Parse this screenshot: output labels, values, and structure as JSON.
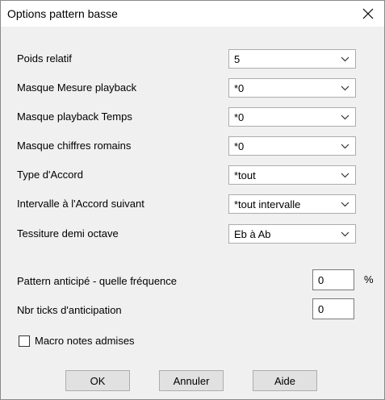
{
  "dialog": {
    "title": "Options pattern basse"
  },
  "fields": [
    {
      "label": "Poids relatif",
      "value": "5"
    },
    {
      "label": "Masque Mesure playback",
      "value": "*0"
    },
    {
      "label": "Masque playback Temps",
      "value": "*0"
    },
    {
      "label": "Masque chiffres romains",
      "value": "*0"
    },
    {
      "label": "Type d'Accord",
      "value": "*tout"
    },
    {
      "label": "Intervalle à l'Accord suivant",
      "value": "*tout intervalle"
    },
    {
      "label": "Tessiture demi octave",
      "value": "Eb à Ab"
    }
  ],
  "anticipation": {
    "frequency_label": "Pattern anticipé - quelle fréquence",
    "frequency_value": "0",
    "frequency_unit": "%",
    "ticks_label": "Nbr ticks d'anticipation",
    "ticks_value": "0"
  },
  "macro": {
    "label": "Macro notes admises",
    "checked": false
  },
  "buttons": {
    "ok": "OK",
    "cancel": "Annuler",
    "help": "Aide"
  }
}
